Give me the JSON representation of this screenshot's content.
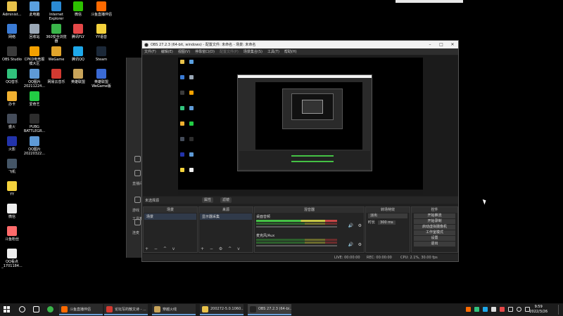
{
  "desktop": {
    "col1": [
      {
        "label": "Administ...",
        "color": "#e8c24a",
        "icon": "user-folder-icon"
      },
      {
        "label": "网络",
        "color": "#3a7bd5",
        "icon": "network-icon"
      },
      {
        "label": "OBS Studio",
        "color": "#3a3a3a",
        "icon": "obs-icon"
      },
      {
        "label": "QQ音乐",
        "color": "#31c27c",
        "icon": "qqmusic-icon"
      },
      {
        "label": "办卡",
        "color": "#f0b030",
        "icon": "card-icon"
      },
      {
        "label": "盛火",
        "color": "#444c5a",
        "icon": "game-icon"
      },
      {
        "label": "火影",
        "color": "#2233aa",
        "icon": "naruto-icon"
      },
      {
        "label": "飞机",
        "color": "#445566",
        "icon": "plane-icon"
      },
      {
        "label": "YY",
        "color": "#f4d23c",
        "icon": "yy-icon"
      },
      {
        "label": "微信",
        "color": "#eeeeee",
        "icon": "wechat-icon"
      },
      {
        "label": "斗鱼粉丝",
        "color": "#ff6b6b",
        "icon": "douyu-icon"
      },
      {
        "label": "QQ看点\n_1701184...",
        "color": "#eeeeee",
        "icon": "document-icon"
      }
    ],
    "col2": [
      {
        "label": "此电脑",
        "color": "#5aa0e0",
        "icon": "computer-icon"
      },
      {
        "label": "回收站",
        "color": "#9aa7b5",
        "icon": "recycle-bin-icon"
      },
      {
        "label": "CPKD电竞报\n模大区",
        "color": "#f4a100",
        "icon": "cpkd-icon"
      },
      {
        "label": "QQ图片\n20211224...",
        "color": "#5e9ad6",
        "icon": "image-icon"
      },
      {
        "label": "爱奇艺",
        "color": "#22cc44",
        "icon": "iqiyi-icon"
      },
      {
        "label": "PUBG\nBATTLEGR...",
        "color": "#2d2d2d",
        "icon": "pubg-icon"
      },
      {
        "label": "QQ图片\n20220322...",
        "color": "#5e9ad6",
        "icon": "image-icon"
      }
    ],
    "col3": [
      {
        "label": "Internet\nExplorer",
        "color": "#2a8ad4",
        "icon": "ie-icon"
      },
      {
        "label": "360安全浏览\n器",
        "color": "#3ab54a",
        "icon": "360-browser-icon"
      },
      {
        "label": "WeGame",
        "color": "#e2a52b",
        "icon": "wegame-icon"
      },
      {
        "label": "网易云音乐",
        "color": "#d33a31",
        "icon": "netease-music-icon"
      }
    ],
    "col4": [
      {
        "label": "微信",
        "color": "#2dc100",
        "icon": "wechat-icon"
      },
      {
        "label": "腾讯FLY",
        "color": "#e54848",
        "icon": "flyer-icon"
      },
      {
        "label": "腾讯QQ",
        "color": "#1ea8ea",
        "icon": "qq-icon"
      },
      {
        "label": "英雄联盟",
        "color": "#c8a45a",
        "icon": "lol-icon"
      }
    ],
    "col5": [
      {
        "label": "斗鱼直播伴侣",
        "color": "#ff6a00",
        "icon": "douyu-live-icon"
      },
      {
        "label": "YY语音",
        "color": "#f4d23c",
        "icon": "yy-voice-icon"
      },
      {
        "label": "Steam",
        "color": "#1b2838",
        "icon": "steam-icon"
      },
      {
        "label": "英雄联盟\nWeGame版",
        "color": "#3a6ad4",
        "icon": "lol-wegame-icon"
      }
    ]
  },
  "bg_window": {
    "labels": [
      "工具箱",
      "直播间",
      "游戏",
      "连麦"
    ]
  },
  "obs": {
    "title": "OBS 27.2.3 (64-bit, windows) - 配置文件: 未命名 - 场景: 未命名",
    "menu": [
      "文件(F)",
      "编辑(E)",
      "视图(V)",
      "停靠窗口(D)",
      "配置文件(P)",
      "场景集合(S)",
      "工具(T)",
      "帮助(H)"
    ],
    "scene_name": "未选择源",
    "scene_chips": [
      "属性",
      "滤镜"
    ],
    "docks": {
      "scenes": {
        "title": "场景",
        "items": [
          "场景"
        ]
      },
      "sources": {
        "title": "来源",
        "items": [
          "显示器采集"
        ]
      },
      "mixer": {
        "title": "混音器",
        "tracks": [
          {
            "name": "桌面音频",
            "level": "0.0 dB"
          },
          {
            "name": "麦克风/Aux",
            "level": "0.0 dB"
          }
        ]
      },
      "transitions": {
        "title": "转场特效",
        "type": "淡出",
        "duration_label": "时长",
        "duration": "300 ms"
      },
      "controls": {
        "title": "控件",
        "buttons": [
          "开始推流",
          "开始录制",
          "启动虚拟摄像机",
          "工作室模式",
          "设置",
          "退出"
        ]
      }
    },
    "status": {
      "live": "LIVE: 00:00:00",
      "rec": "REC: 00:00:00",
      "cpu": "CPU: 2.1%, 30.00 fps"
    }
  },
  "taskbar": {
    "tasks": [
      {
        "label": "斗鱼直播伴侣",
        "color": "#ff6a00"
      },
      {
        "label": "论坛写的散文诗 - ...",
        "color": "#d33a31"
      },
      {
        "label": "穿越火线",
        "color": "#c8a45a"
      },
      {
        "label": "200272-5.0.1060...",
        "color": "#e8c24a"
      },
      {
        "label": "OBS 27.2.3 (64-bi...",
        "color": "#222222"
      }
    ],
    "time": "9:59",
    "date": "2022/3/26"
  }
}
